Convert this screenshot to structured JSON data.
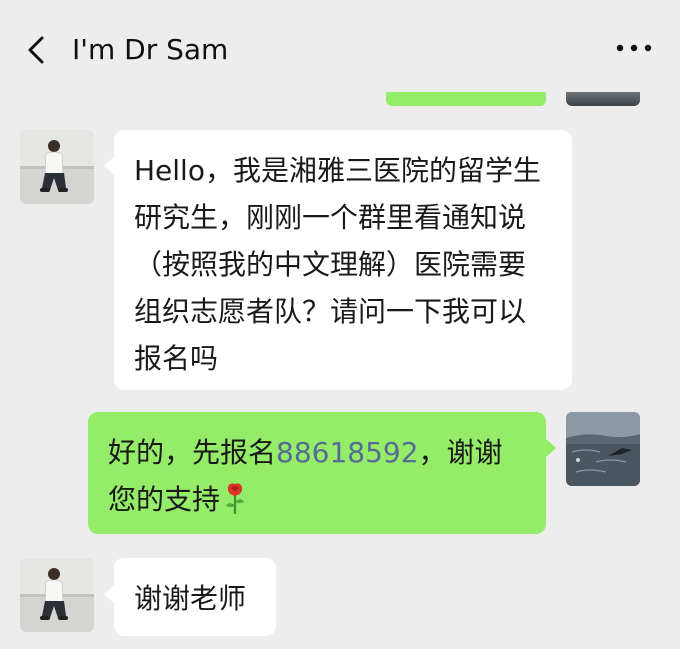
{
  "header": {
    "title": "I'm Dr Sam"
  },
  "messages": [
    {
      "sender": "Dr Sam",
      "direction": "incoming",
      "text": "Hello，我是湘雅三医院的留学生研究生，刚刚一个群里看通知说（按照我的中文理解）医院需要组织志愿者队？请问一下我可以报名吗"
    },
    {
      "sender": "me",
      "direction": "outgoing",
      "text_before": "好的，先报名",
      "phone_number": "88618592",
      "text_after": "，谢谢您的支持",
      "emoji": "rose-icon"
    },
    {
      "sender": "Dr Sam",
      "direction": "incoming",
      "text": "谢谢老师"
    }
  ],
  "colors": {
    "background": "#ededed",
    "incoming_bubble": "#ffffff",
    "outgoing_bubble": "#95ec69",
    "link": "#576b95",
    "text": "#191919"
  }
}
